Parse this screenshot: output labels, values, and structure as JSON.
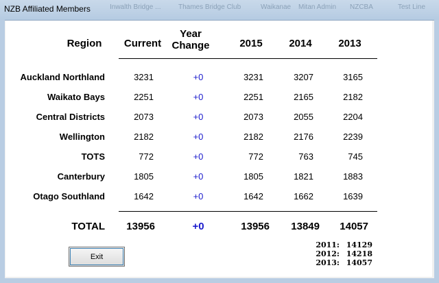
{
  "window": {
    "title": "NZB Affiliated Members"
  },
  "background_tabs": [
    "Inwalth Bridge ...",
    "Thames Bridge Club",
    "Waikanae",
    "Mitan Admin",
    "NZCBA",
    "Test Line"
  ],
  "headers": {
    "region": "Region",
    "current": "Current",
    "year_change_1": "Year",
    "year_change_2": "Change",
    "y2015": "2015",
    "y2014": "2014",
    "y2013": "2013"
  },
  "rows": [
    {
      "region": "Auckland Northland",
      "current": "3231",
      "change": "+0",
      "y2015": "3231",
      "y2014": "3207",
      "y2013": "3165"
    },
    {
      "region": "Waikato Bays",
      "current": "2251",
      "change": "+0",
      "y2015": "2251",
      "y2014": "2165",
      "y2013": "2182"
    },
    {
      "region": "Central Districts",
      "current": "2073",
      "change": "+0",
      "y2015": "2073",
      "y2014": "2055",
      "y2013": "2204"
    },
    {
      "region": "Wellington",
      "current": "2182",
      "change": "+0",
      "y2015": "2182",
      "y2014": "2176",
      "y2013": "2239"
    },
    {
      "region": "TOTS",
      "current": "772",
      "change": "+0",
      "y2015": "772",
      "y2014": "763",
      "y2013": "745"
    },
    {
      "region": "Canterbury",
      "current": "1805",
      "change": "+0",
      "y2015": "1805",
      "y2014": "1821",
      "y2013": "1883"
    },
    {
      "region": "Otago Southland",
      "current": "1642",
      "change": "+0",
      "y2015": "1642",
      "y2014": "1662",
      "y2013": "1639"
    }
  ],
  "total": {
    "label": "TOTAL",
    "current": "13956",
    "change": "+0",
    "y2015": "13956",
    "y2014": "13849",
    "y2013": "14057"
  },
  "history": [
    {
      "year": "2011:",
      "value": "14129"
    },
    {
      "year": "2012:",
      "value": "14218"
    },
    {
      "year": "2013:",
      "value": "14057"
    }
  ],
  "exit_label": "Exit"
}
